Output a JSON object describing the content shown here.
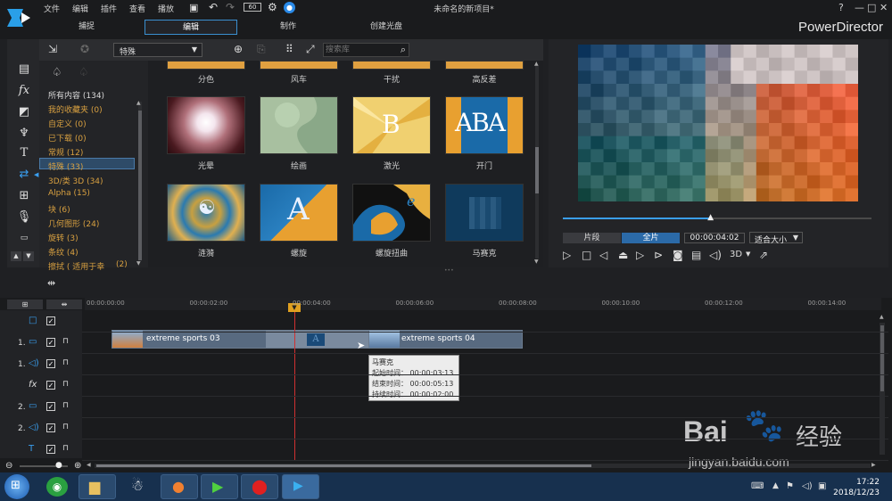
{
  "titlebar": {
    "menu": [
      "文件",
      "编辑",
      "插件",
      "查看",
      "播放"
    ],
    "fps": "60",
    "window_title": "未命名的新项目*",
    "brand": "PowerDirector",
    "help": "?",
    "minimize": "—",
    "maximize": "□",
    "close": "✕"
  },
  "tabs": [
    "捕捉",
    "编辑",
    "制作",
    "创建光盘"
  ],
  "library": {
    "dropdown": "特殊",
    "search_placeholder": "搜索库",
    "categories": [
      {
        "label": "所有内容 (134)",
        "color": "white"
      },
      {
        "label": "我的收藏夹 (0)",
        "color": "orange"
      },
      {
        "label": "自定义 (0)",
        "color": "orange"
      },
      {
        "label": "已下载 (0)",
        "color": "orange"
      },
      {
        "label": "常规 (12)",
        "color": "orange"
      },
      {
        "label": "特殊 (33)",
        "color": "orange"
      },
      {
        "label": "3D/类 3D (34)",
        "color": "orange"
      },
      {
        "label": "Alpha (15)",
        "color": "orange"
      },
      {
        "label": "块 (6)",
        "color": "orange"
      },
      {
        "label": "几何图形 (24)",
        "color": "orange"
      },
      {
        "label": "旋转 (3)",
        "color": "orange"
      },
      {
        "label": "条纹 (4)",
        "color": "orange"
      },
      {
        "label": "擦拭 ( 适用于幸",
        "color": "orange"
      }
    ],
    "category_last_count": "(2)",
    "row1_labels": [
      "分色",
      "风车",
      "干扰",
      "高反差"
    ],
    "row2_labels": [
      "光晕",
      "绘画",
      "激光",
      "开门"
    ],
    "row3_labels": [
      "涟漪",
      "螺旋",
      "螺旋扭曲",
      "马赛克"
    ],
    "thumb_text_A": "A",
    "thumb_text_B": "B",
    "thumb_text_ABA": "ABA",
    "thumb_text_e": "e"
  },
  "preview": {
    "mode_clip": "片段",
    "mode_movie": "全片",
    "timecode": "00:00:04:02",
    "fit": "适合大小",
    "three_d": "3D",
    "progress": 0.48
  },
  "timeline": {
    "ruler": [
      "00:00:00:00",
      "00:00:02:00",
      "00:00:04:00",
      "00:00:06:00",
      "00:00:08:00",
      "00:00:10:00",
      "00:00:12:00",
      "00:00:14:00"
    ],
    "tracks": [
      {
        "num": "",
        "kind": "master"
      },
      {
        "num": "1.",
        "kind": "video"
      },
      {
        "num": "1.",
        "kind": "audio"
      },
      {
        "num": "",
        "kind": "fx"
      },
      {
        "num": "2.",
        "kind": "video"
      },
      {
        "num": "2.",
        "kind": "audio"
      },
      {
        "num": "",
        "kind": "title"
      }
    ],
    "clip1": "extreme sports 03",
    "clip2": "extreme sports 04",
    "transition_letter": "A",
    "tooltip": {
      "title": "马赛克",
      "start": "起始时间： 00:00:03:13",
      "end": "结束时间： 00:00:05:13",
      "duration": "持续时间： 00:00:02:00"
    }
  },
  "taskbar": {
    "time": "17:22",
    "date": "2018/12/23"
  },
  "watermark": {
    "brand": "Bai",
    "brand2": "经验",
    "url": "jingyan.baidu.com"
  },
  "colors": {
    "accent": "#3a9ff0",
    "category_orange": "#d8a040",
    "playhead": "#d03030"
  }
}
